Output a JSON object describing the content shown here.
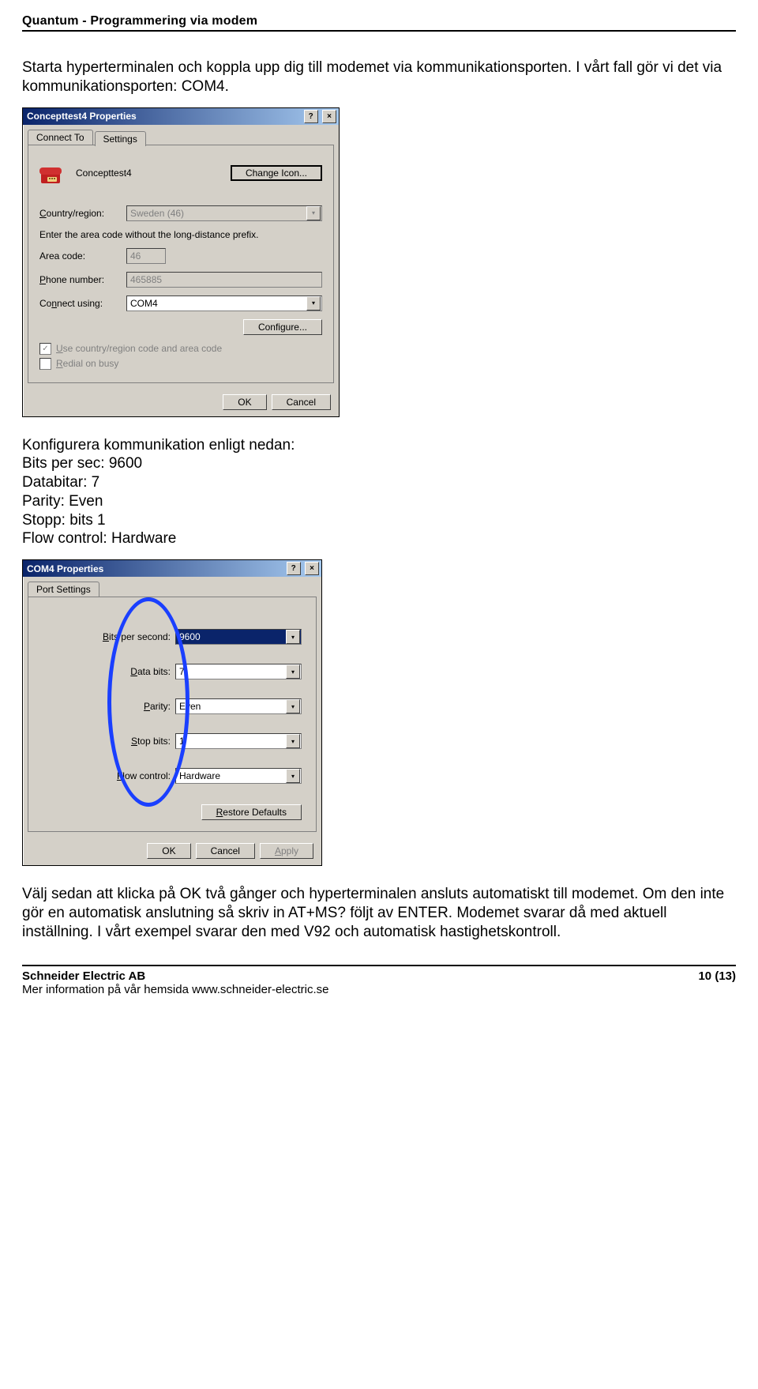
{
  "header": {
    "title": "Quantum - Programmering via modem"
  },
  "intro": {
    "para": "Starta hyperterminalen och koppla upp dig till modemet via kommunikationsporten. I vårt fall gör vi det via kommunikationsporten: COM4."
  },
  "dlg1": {
    "title": "Concepttest4 Properties",
    "help_glyph": "?",
    "close_glyph": "×",
    "tab1": "Connect To",
    "tab2": "Settings",
    "conn_name": "Concepttest4",
    "change_icon_btn": "Change Icon...",
    "country_label_pre": "C",
    "country_label_rest": "ountry/region:",
    "country_value": "Sweden (46)",
    "area_hint": "Enter the area code without the long-distance prefix.",
    "area_label": "Area code:",
    "area_value": "46",
    "phone_label_pre": "P",
    "phone_label_rest": "hone number:",
    "phone_value": "465885",
    "connect_label_pre": "Co",
    "connect_label_mid": "n",
    "connect_label_rest": "nect using:",
    "connect_value": "COM4",
    "configure_btn": "Configure...",
    "cb1_pre": "U",
    "cb1_rest": "se country/region code and area code",
    "cb2_pre": "R",
    "cb2_rest": "edial on busy",
    "ok": "OK",
    "cancel": "Cancel"
  },
  "mid_text": {
    "l1": "Konfigurera kommunikation enligt nedan:",
    "l2": "Bits per sec: 9600",
    "l3": "Databitar: 7",
    "l4": "Parity: Even",
    "l5": "Stopp: bits 1",
    "l6": "Flow control: Hardware"
  },
  "dlg2": {
    "title": "COM4 Properties",
    "help_glyph": "?",
    "close_glyph": "×",
    "tab1": "Port Settings",
    "bits_label_pre": "B",
    "bits_label_rest": "its per second:",
    "bits_value": "9600",
    "data_label_pre": "D",
    "data_label_rest": "ata bits:",
    "data_value": "7",
    "parity_label_pre": "P",
    "parity_label_rest": "arity:",
    "parity_value": "Even",
    "stop_label_pre": "S",
    "stop_label_rest": "top bits:",
    "stop_value": "1",
    "flow_label_pre": "F",
    "flow_label_rest": "low control:",
    "flow_value": "Hardware",
    "restore_btn_pre": "R",
    "restore_btn_rest": "estore Defaults",
    "ok": "OK",
    "cancel": "Cancel",
    "apply_pre": "A",
    "apply_rest": "pply"
  },
  "outro": {
    "para": "Välj sedan att klicka på OK två gånger och hyperterminalen ansluts automatiskt till modemet. Om den inte gör en automatisk anslutning så  skriv in AT+MS? följt av ENTER. Modemet svarar då med aktuell inställning. I vårt exempel svarar den med V92 och automatisk hastighetskontroll."
  },
  "footer": {
    "company": "Schneider Electric AB",
    "sub": "Mer information på vår hemsida www.schneider-electric.se",
    "page": "10 (13)"
  }
}
